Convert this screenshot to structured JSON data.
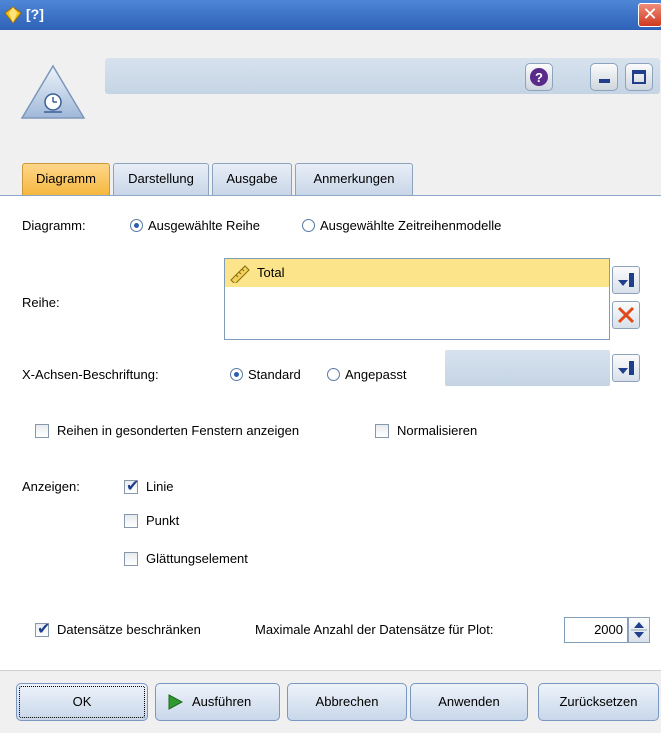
{
  "window": {
    "title": "[?]",
    "close_glyph": "✕"
  },
  "header": {
    "help_glyph": "?",
    "node_icon": "time-plot-node-icon"
  },
  "tabs": [
    {
      "label": "Diagramm",
      "active": true
    },
    {
      "label": "Darstellung",
      "active": false
    },
    {
      "label": "Ausgabe",
      "active": false
    },
    {
      "label": "Anmerkungen",
      "active": false
    }
  ],
  "plot": {
    "label": "Diagramm:",
    "options": [
      "Ausgewählte Reihe",
      "Ausgewählte Zeitreihenmodelle"
    ],
    "selected": "Ausgewählte Reihe"
  },
  "series": {
    "label": "Reihe:",
    "items": [
      "Total"
    ]
  },
  "xaxis": {
    "label": "X-Achsen-Beschriftung:",
    "options": [
      "Standard",
      "Angepasst"
    ],
    "selected": "Standard"
  },
  "options": {
    "separate_windows": {
      "label": "Reihen in gesonderten Fenstern anzeigen",
      "checked": false
    },
    "normalize": {
      "label": "Normalisieren",
      "checked": false
    }
  },
  "display": {
    "label": "Anzeigen:",
    "line": {
      "label": "Linie",
      "checked": true
    },
    "point": {
      "label": "Punkt",
      "checked": false
    },
    "smoother": {
      "label": "Glättungselement",
      "checked": false
    }
  },
  "limit": {
    "label": "Datensätze beschränken",
    "checked": true,
    "max_label": "Maximale Anzahl der Datensätze für Plot:",
    "max_value": "2000"
  },
  "buttons": {
    "ok": "OK",
    "run": "Ausführen",
    "cancel": "Abbrechen",
    "apply": "Anwenden",
    "reset": "Zurücksetzen"
  },
  "colors": {
    "titlebar": "#2d62b8",
    "active_tab": "#f5b83f",
    "selected_item": "#fbe48a",
    "run_arrow": "#2f9a2f"
  }
}
